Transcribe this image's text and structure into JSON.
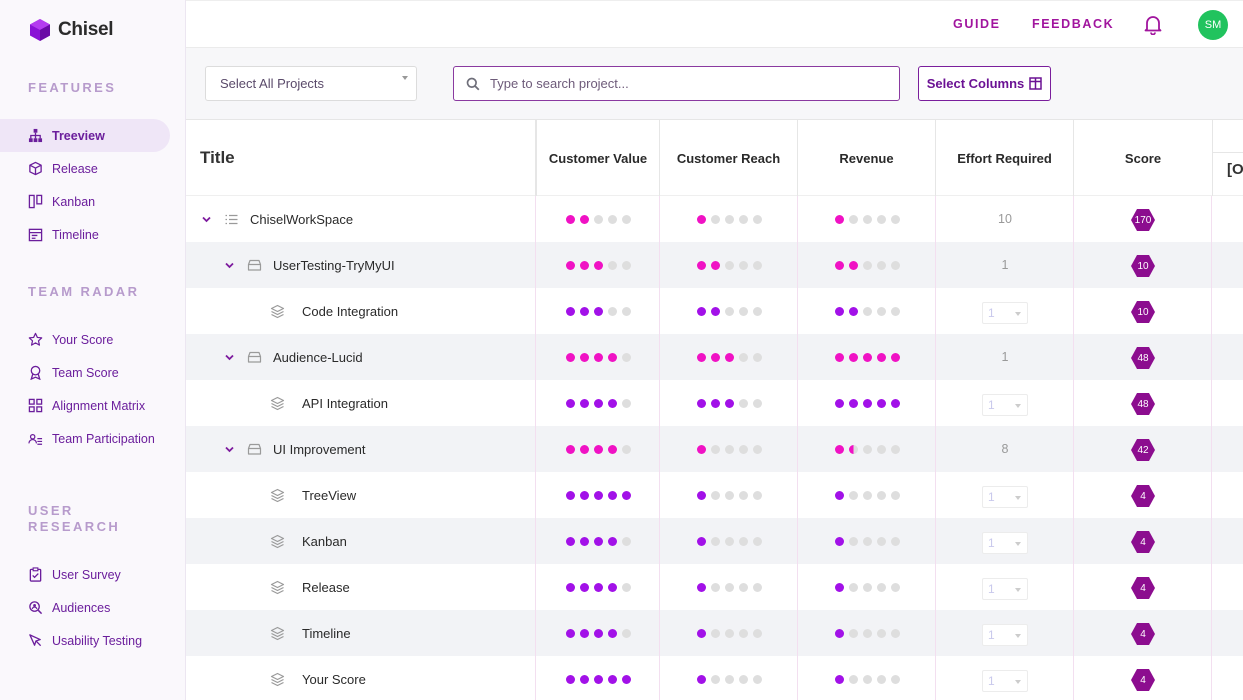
{
  "app": {
    "name": "Chisel"
  },
  "colors": {
    "accent": "#7d1a9e",
    "pink": "#f012c4",
    "purple": "#a211e8",
    "dot_empty": "#dedede",
    "avatar": "#21c35e",
    "hex": "#8c0d8f"
  },
  "sidebar": {
    "sections": [
      {
        "title": "FEATURES",
        "items": [
          {
            "label": "Treeview",
            "icon": "tree-icon",
            "active": true
          },
          {
            "label": "Release",
            "icon": "box-icon"
          },
          {
            "label": "Kanban",
            "icon": "kanban-icon"
          },
          {
            "label": "Timeline",
            "icon": "calendar-icon"
          }
        ]
      },
      {
        "title": "TEAM RADAR",
        "items": [
          {
            "label": "Your Score",
            "icon": "star-icon"
          },
          {
            "label": "Team Score",
            "icon": "award-icon"
          },
          {
            "label": "Alignment Matrix",
            "icon": "grid-icon"
          },
          {
            "label": "Team Participation",
            "icon": "people-icon"
          }
        ]
      },
      {
        "title": "USER RESEARCH",
        "items": [
          {
            "label": "User Survey",
            "icon": "clipboard-icon"
          },
          {
            "label": "Audiences",
            "icon": "search-people-icon"
          },
          {
            "label": "Usability Testing",
            "icon": "cursor-icon"
          }
        ]
      }
    ]
  },
  "topbar": {
    "guide": "GUIDE",
    "feedback": "FEEDBACK",
    "avatar_initials": "SM"
  },
  "filters": {
    "project_select": "Select All Projects",
    "search_placeholder": "Type to search project...",
    "select_columns": "Select Columns"
  },
  "table": {
    "columns": [
      "Title",
      "Customer Value",
      "Customer Reach",
      "Revenue",
      "Effort Required",
      "Score"
    ],
    "extra_column_fragment": "[O",
    "rows": [
      {
        "title": "ChiselWorkSpace",
        "level": 0,
        "icon": "list-icon",
        "expand": true,
        "cv": 2,
        "cr": 1,
        "rev": 1,
        "effort": "10",
        "effort_type": "text",
        "score": "170",
        "color": "pink"
      },
      {
        "title": "UserTesting-TryMyUI",
        "level": 1,
        "icon": "folder-icon",
        "expand": true,
        "cv": 3,
        "cr": 2,
        "rev": 2,
        "effort": "1",
        "effort_type": "text",
        "score": "10",
        "color": "pink"
      },
      {
        "title": "Code Integration",
        "level": 2,
        "icon": "layers-icon",
        "expand": false,
        "cv": 3,
        "cr": 2,
        "rev": 2,
        "effort": "1",
        "effort_type": "select",
        "score": "10",
        "color": "purple"
      },
      {
        "title": "Audience-Lucid",
        "level": 1,
        "icon": "folder-icon",
        "expand": true,
        "cv": 4,
        "cr": 3,
        "rev": 5,
        "effort": "1",
        "effort_type": "text",
        "score": "48",
        "color": "pink"
      },
      {
        "title": "API Integration",
        "level": 2,
        "icon": "layers-icon",
        "expand": false,
        "cv": 4,
        "cr": 3,
        "rev": 5,
        "effort": "1",
        "effort_type": "select",
        "score": "48",
        "color": "purple"
      },
      {
        "title": "UI Improvement",
        "level": 1,
        "icon": "folder-icon",
        "expand": true,
        "cv": 4,
        "cr": 1,
        "rev": 1.5,
        "effort": "8",
        "effort_type": "text",
        "score": "42",
        "color": "pink"
      },
      {
        "title": "TreeView",
        "level": 2,
        "icon": "layers-icon",
        "expand": false,
        "cv": 5,
        "cr": 1,
        "rev": 1,
        "effort": "1",
        "effort_type": "select",
        "score": "4",
        "color": "purple"
      },
      {
        "title": "Kanban",
        "level": 2,
        "icon": "layers-icon",
        "expand": false,
        "cv": 4,
        "cr": 1,
        "rev": 1,
        "effort": "1",
        "effort_type": "select",
        "score": "4",
        "color": "purple"
      },
      {
        "title": "Release",
        "level": 2,
        "icon": "layers-icon",
        "expand": false,
        "cv": 4,
        "cr": 1,
        "rev": 1,
        "effort": "1",
        "effort_type": "select",
        "score": "4",
        "color": "purple"
      },
      {
        "title": "Timeline",
        "level": 2,
        "icon": "layers-icon",
        "expand": false,
        "cv": 4,
        "cr": 1,
        "rev": 1,
        "effort": "1",
        "effort_type": "select",
        "score": "4",
        "color": "purple"
      },
      {
        "title": "Your Score",
        "level": 2,
        "icon": "layers-icon",
        "expand": false,
        "cv": 5,
        "cr": 1,
        "rev": 1,
        "effort": "1",
        "effort_type": "select",
        "score": "4",
        "color": "purple"
      }
    ]
  }
}
